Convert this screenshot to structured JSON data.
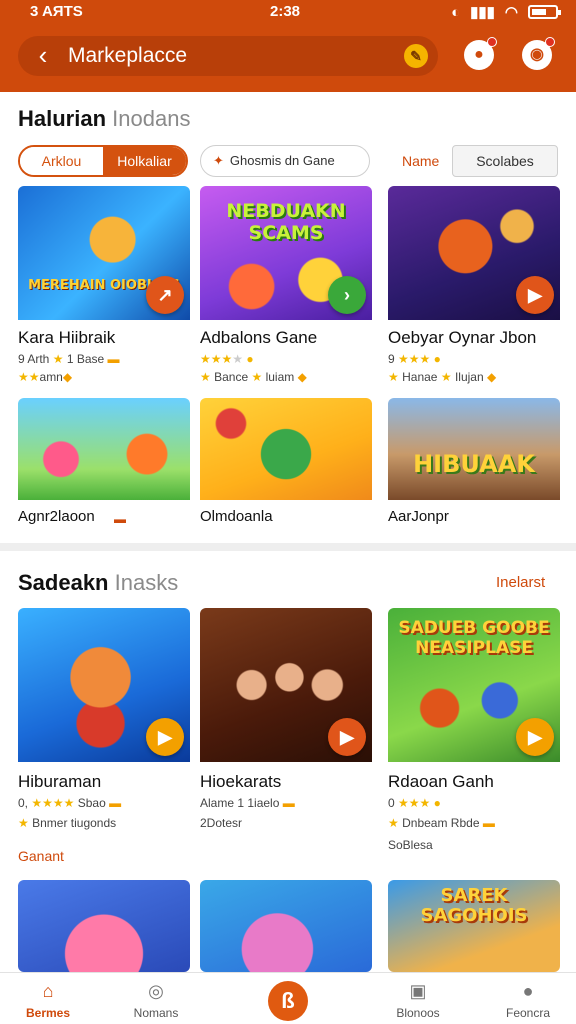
{
  "status": {
    "left": "3 AЯTS",
    "time": "2:38"
  },
  "header": {
    "title": "Markeplacce",
    "back_icon": "chevron-left-icon",
    "coin_icon": "coin-icon",
    "notif_icon": "notification-icon",
    "cart_icon": "cart-icon"
  },
  "section1": {
    "title_bold": "Halurian",
    "title_light": "Inodans",
    "segment": {
      "left": "Arklou",
      "right": "Holkaliar"
    },
    "chip": "Ghosmis dn Gane",
    "sort_label": "Name",
    "sort_value": "Scolabes",
    "cards": [
      {
        "title": "Kara Hiibraik",
        "line1": "9 Arth",
        "line1b": "1 Base",
        "line2": "amn",
        "logo": "MEREHAIN OIOBIASS"
      },
      {
        "title": "Adbalons Gane",
        "line1": "",
        "line1b": "",
        "line2": "Bance",
        "line2b": "luiam",
        "logo": "NEBDUAKN SCAMS"
      },
      {
        "title": "Oebyar Oynar Jbon",
        "line1": "9",
        "line1b": "",
        "line2": "Hanae",
        "line2b": "Ilujan",
        "logo": ""
      },
      {
        "title": "Agnr2laoon",
        "logo": ""
      },
      {
        "title": "Olmdoanla",
        "logo": ""
      },
      {
        "title": "AarJonpr",
        "logo": "HIBUAAK"
      }
    ]
  },
  "section2": {
    "title_bold": "Sadeakn",
    "title_light": "Inasks",
    "action": "Inelarst",
    "cards": [
      {
        "title": "Hiburaman",
        "line1": "0,",
        "line1b": "Sbao",
        "line2": "Bnmer tiugonds"
      },
      {
        "title": "Hioekarats",
        "line1": "Alame 1 1iaelo",
        "line2": "2Dotesr"
      },
      {
        "title": "Rdaoan Ganh",
        "line1": "0",
        "line2": "Dnbeam Rbde",
        "line3": "SoBlesa",
        "logo": "SADUEB GOOBE NEASIPLASE"
      }
    ],
    "sub_label": "Ganant",
    "row3_logo": "SAREK SAGOHOIS"
  },
  "nav": {
    "items": [
      "Bermes",
      "Nomans",
      "",
      "Blonoos",
      "Feoncra"
    ]
  },
  "colors": {
    "brand": "#cf4a0c",
    "star": "#f3b600"
  }
}
